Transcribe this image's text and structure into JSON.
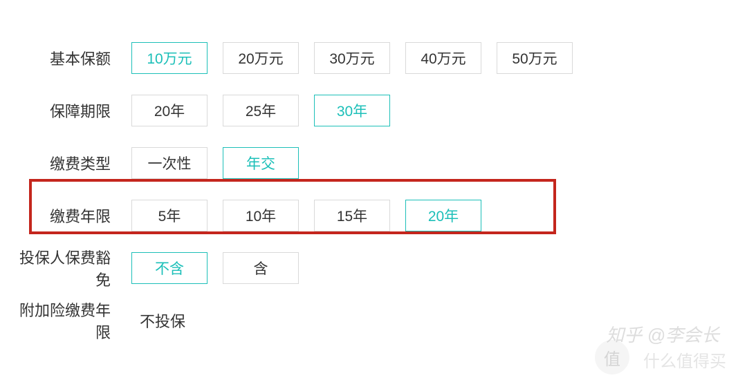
{
  "rows": {
    "basic_amount": {
      "label": "基本保额",
      "options": [
        "10万元",
        "20万元",
        "30万元",
        "40万元",
        "50万元"
      ],
      "selected": 0
    },
    "coverage_period": {
      "label": "保障期限",
      "options": [
        "20年",
        "25年",
        "30年"
      ],
      "selected": 2
    },
    "payment_type": {
      "label": "缴费类型",
      "options": [
        "一次性",
        "年交"
      ],
      "selected": 1
    },
    "payment_years": {
      "label": "缴费年限",
      "options": [
        "5年",
        "10年",
        "15年",
        "20年"
      ],
      "selected": 3
    },
    "waiver": {
      "label": "投保人保费豁免",
      "options": [
        "不含",
        "含"
      ],
      "selected": 0
    },
    "additional": {
      "label": "附加险缴费年限",
      "value": "不投保"
    }
  },
  "watermark": {
    "line1": "知乎 @李会长",
    "line2": "什么值得买",
    "badge": "值"
  }
}
